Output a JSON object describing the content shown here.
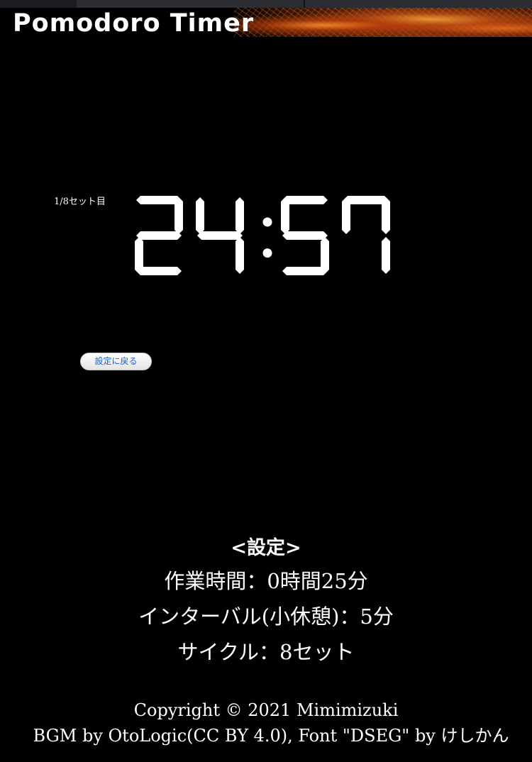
{
  "app": {
    "title": "Pomodoro Timer"
  },
  "timer": {
    "set_counter": "1/8セット目",
    "display": "24:57"
  },
  "controls": {
    "back_to_settings_label": "設定に戻る"
  },
  "settings": {
    "heading": "<設定>",
    "work_time": "作業時間：0時間25分",
    "interval": "インターバル(小休憩)：5分",
    "cycle": "サイクル：8セット"
  },
  "footer": {
    "copyright": "Copyright © 2021 Mimimizuki",
    "credits": "BGM by OtoLogic(CC BY 4.0), Font \"DSEG\" by けしかん"
  },
  "colors": {
    "background": "#000000",
    "text": "#ffffff",
    "button_text": "#1a5fd0",
    "header_accent": "#c85a14"
  }
}
